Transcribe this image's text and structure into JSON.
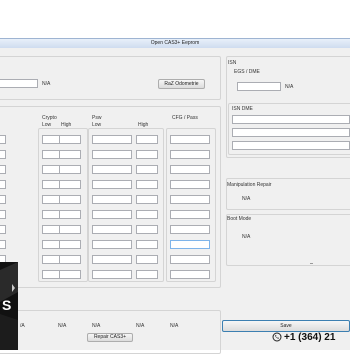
{
  "window": {
    "title": "Open CAS3+ Eeprom"
  },
  "odometer": {
    "value": "N/A",
    "button_label": "RaZ Odometrie"
  },
  "isn": {
    "group_title": "ISN",
    "egs_label": "EGS / DME",
    "egs_value": "N/A",
    "isn_dme_label": "ISN DME"
  },
  "keys": {
    "crypto_label": "Crypto",
    "psw_label": "Psw",
    "cfg_label": "CFG / Pass",
    "low_label": "Low",
    "high_label": "High",
    "rows": 10
  },
  "manipulation": {
    "label": "Manipulation Repair",
    "value": "N/A"
  },
  "boot": {
    "label": "Boot Mode",
    "value": "N/A"
  },
  "bottom": {
    "values": [
      "/A",
      "N/A",
      "N/A",
      "N/A",
      "N/A"
    ],
    "repair_button": "Repair CAS3+"
  },
  "save": {
    "label": "Save"
  },
  "overlay": {
    "phone": "+1 (364) 21"
  }
}
